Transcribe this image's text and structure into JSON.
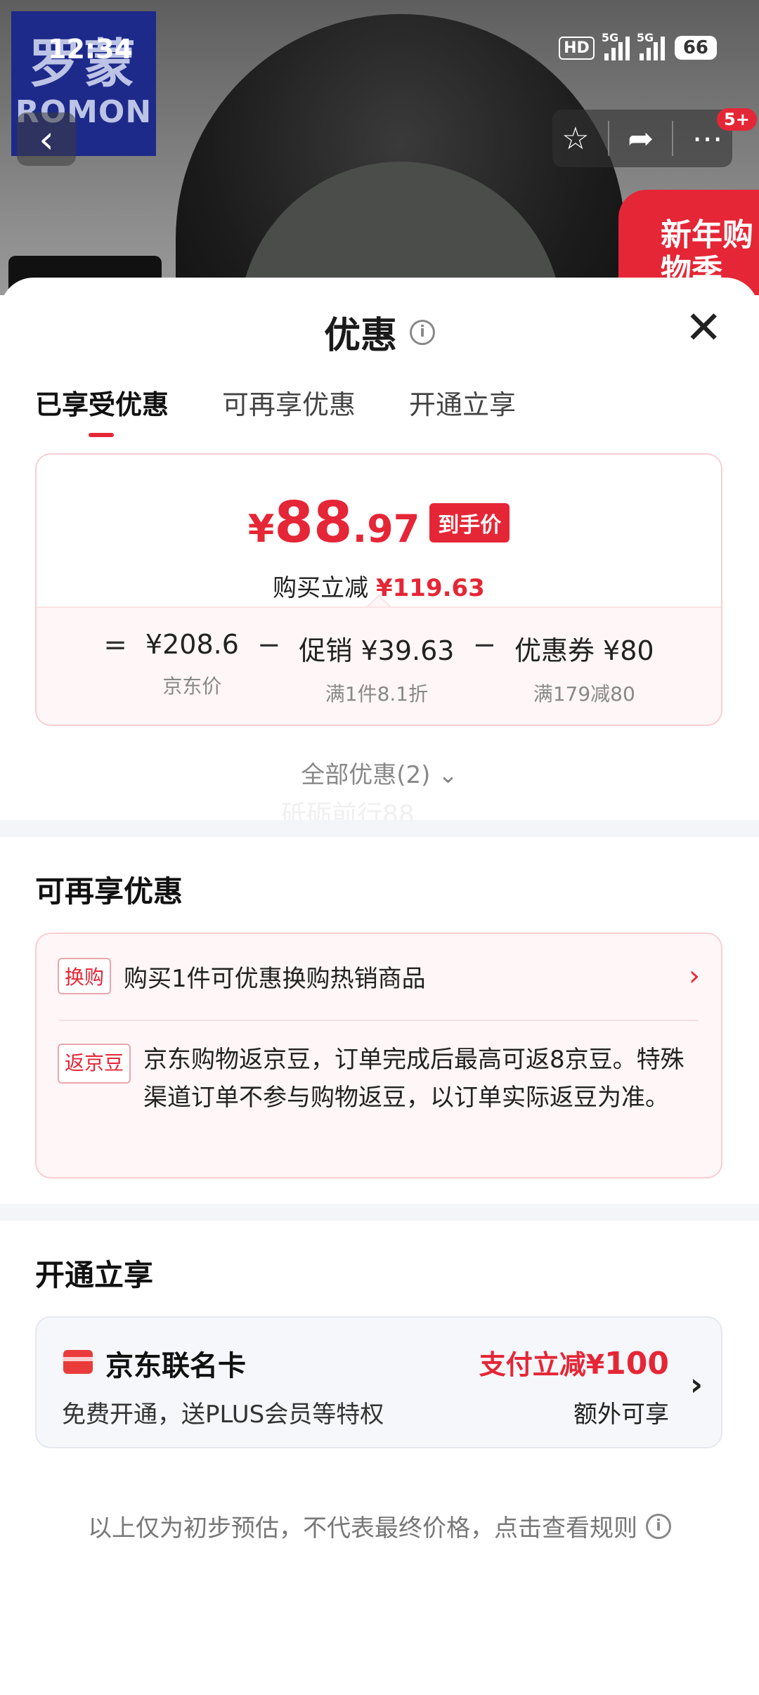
{
  "status_bar": {
    "time": "12:34",
    "hd": "HD",
    "net1": "5G",
    "net2": "5G",
    "battery": "66"
  },
  "background": {
    "logo_cn": "罗蒙",
    "logo_en": "ROMON",
    "promo_text": "新年购物季",
    "cart_badge": "5+"
  },
  "sheet": {
    "title": "优惠",
    "tabs": [
      {
        "label": "已享受优惠"
      },
      {
        "label": "可再享优惠"
      },
      {
        "label": "开通立享"
      }
    ],
    "price": {
      "currency": "¥",
      "integer": "88",
      "decimal": ".97",
      "tag": "到手价",
      "reduce_label": "购买立减",
      "reduce_value": "¥119.63"
    },
    "formula": {
      "eq": "=",
      "jd_price": "¥208.6",
      "jd_label": "京东价",
      "minus": "−",
      "promo_value": "促销 ¥39.63",
      "promo_label": "满1件8.1折",
      "coupon_value": "优惠券 ¥80",
      "coupon_label": "满179减80"
    },
    "all_offers": "全部优惠(2)",
    "watermark": "砥砺前行88",
    "extra_section_title": "可再享优惠",
    "extra": {
      "row1_tag": "换购",
      "row1_text": "购买1件可优惠换购热销商品",
      "row2_tag": "返京豆",
      "row2_text": "京东购物返京豆，订单完成后最高可返8京豆。特殊渠道订单不参与购物返豆，以订单实际返豆为准。"
    },
    "open_section_title": "开通立享",
    "card": {
      "name": "京东联名卡",
      "desc": "免费开通，送PLUS会员等特权",
      "offer_prefix": "支付立减¥",
      "offer_amount": "100",
      "offer_sub": "额外可享"
    },
    "footer": "以上仅为初步预估，不代表最终价格，点击查看规则"
  },
  "colors": {
    "accent": "#e52636"
  }
}
